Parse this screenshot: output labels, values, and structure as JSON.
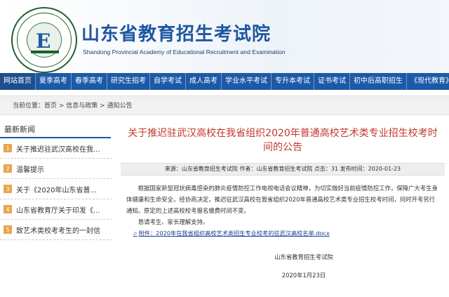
{
  "header": {
    "title": "山东省教育招生考试院",
    "subtitle": "Shandong Provincial Academy of Educational Recruitment and Examination"
  },
  "nav": [
    "网站首页",
    "夏季高考",
    "春季高考",
    "研究生招考",
    "自学考试",
    "成人高考",
    "学业水平考试",
    "专升本考试",
    "证书考试",
    "初中后高职招生",
    "《现代教育》"
  ],
  "breadcrumb": {
    "text": "当前位置：首页 > 信息与政策 > 通知公告"
  },
  "sidebar": {
    "title": "最新新闻",
    "items": [
      {
        "num": "1",
        "label": "关于推迟驻武汉高校在我..."
      },
      {
        "num": "2",
        "label": "温馨提示"
      },
      {
        "num": "3",
        "label": "关于《2020年山东省普..."
      },
      {
        "num": "4",
        "label": "山东省教育厅关于印发《..."
      },
      {
        "num": "5",
        "label": "致艺术类校考考生的一封信"
      }
    ]
  },
  "article": {
    "title": "关于推迟驻武汉高校在我省组织2020年普通高校艺术类专业招生校考时间的公告",
    "meta": "来源：山东省教育招生考试院 作者：山东省教育招生考试院 点击：31 发布时间：2020-01-23",
    "para1": "根据国家新型冠状病毒感染的肺炎疫情防控工作电视电话会议精神，为切实做好当前疫情防控工作，保障广大考生身体健康和生命安全，经协商决定，推迟驻武汉高校在我省组织2020年普通高校艺术类专业招生校考时间，何时开考另行通知。原定的上述高校校考报名缴费时间不变。",
    "para2": "恳请考生、家长理解支持。",
    "attachment": "附件：2020年在我省组织高校艺术类招生专业校考的驻武汉高校名单.docx",
    "signature": "山东省教育招生考试院",
    "date": "2020年1月23日"
  }
}
